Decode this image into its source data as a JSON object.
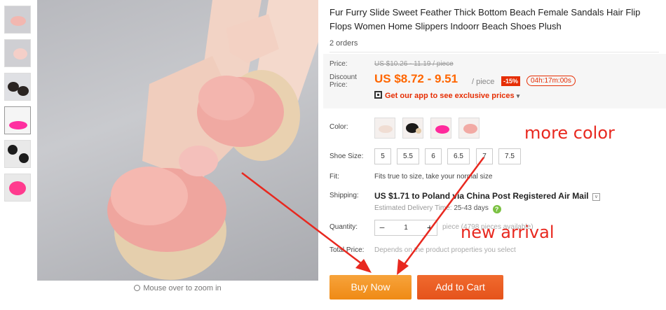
{
  "gallery": {
    "thumbnails": [
      {
        "name": "thumb-1"
      },
      {
        "name": "thumb-2"
      },
      {
        "name": "thumb-3"
      },
      {
        "name": "thumb-4"
      },
      {
        "name": "thumb-5"
      },
      {
        "name": "thumb-6"
      }
    ],
    "zoom_hint": "Mouse over to zoom in"
  },
  "product": {
    "title": "Fur Furry Slide Sweet Feather Thick Bottom Beach Female Sandals Hair Flip Flops Women Home Slippers Indoorr Beach Shoes Plush",
    "orders": "2 orders"
  },
  "price": {
    "price_label": "Price:",
    "original": "US $10.26 - 11.19 / piece",
    "discount_label_1": "Discount",
    "discount_label_2": "Price:",
    "discount": "US $8.72 - 9.51",
    "per_piece": "/ piece",
    "badge": "-15%",
    "timer": "04h:17m:00s",
    "app_text": "Get our app to see exclusive prices",
    "app_caret": "▾"
  },
  "options": {
    "color_label": "Color:",
    "colors": [
      "beige",
      "black",
      "rose-red",
      "pink"
    ],
    "size_label": "Shoe Size:",
    "sizes": [
      "5",
      "5.5",
      "6",
      "6.5",
      "7",
      "7.5"
    ],
    "fit_label": "Fit:",
    "fit_value": "Fits true to size, take your normal size",
    "shipping_label": "Shipping:",
    "shipping_value": "US $1.71 to Poland via China Post Registered Air Mail",
    "shipping_caret": "v",
    "eta_label": "Estimated Delivery Time:",
    "eta_value": "25-43 days",
    "eta_help": "?",
    "quantity_label": "Quantity:",
    "quantity_value": "1",
    "minus": "−",
    "plus": "+",
    "pieces_available": "piece (4798 pieces available)",
    "total_label": "Total Price:",
    "total_value": "Depends on the product properties you select"
  },
  "actions": {
    "buy_now": "Buy Now",
    "add_to_cart": "Add to Cart"
  },
  "annotations": {
    "more_color": "more color",
    "new_arrival": "new arrival",
    "color": "#e8281f"
  }
}
